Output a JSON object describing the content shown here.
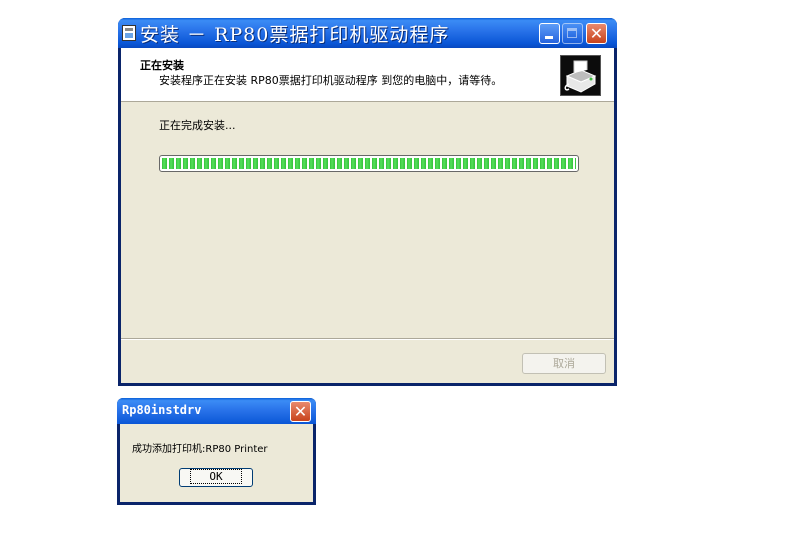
{
  "installer": {
    "title": "安装 － RP80票据打印机驱动程序",
    "header_title": "正在安装",
    "header_subtitle": "安装程序正在安装 RP80票据打印机驱动程序 到您的电脑中，请等待。",
    "header_icon": "printer-install-icon",
    "status_text": "正在完成安装...",
    "progress_fraction": 1.0,
    "cancel_label": "取消",
    "title_buttons": {
      "minimize": "_",
      "maximize": "□",
      "close": "✕"
    },
    "colors": {
      "titlebar": "#2a74ea",
      "progress": "#34c13a",
      "client": "#ece9d8"
    }
  },
  "dialog": {
    "title": "Rp80instdrv",
    "message": "成功添加打印机:RP80 Printer",
    "ok_label": "OK",
    "close_glyph": "✕"
  }
}
